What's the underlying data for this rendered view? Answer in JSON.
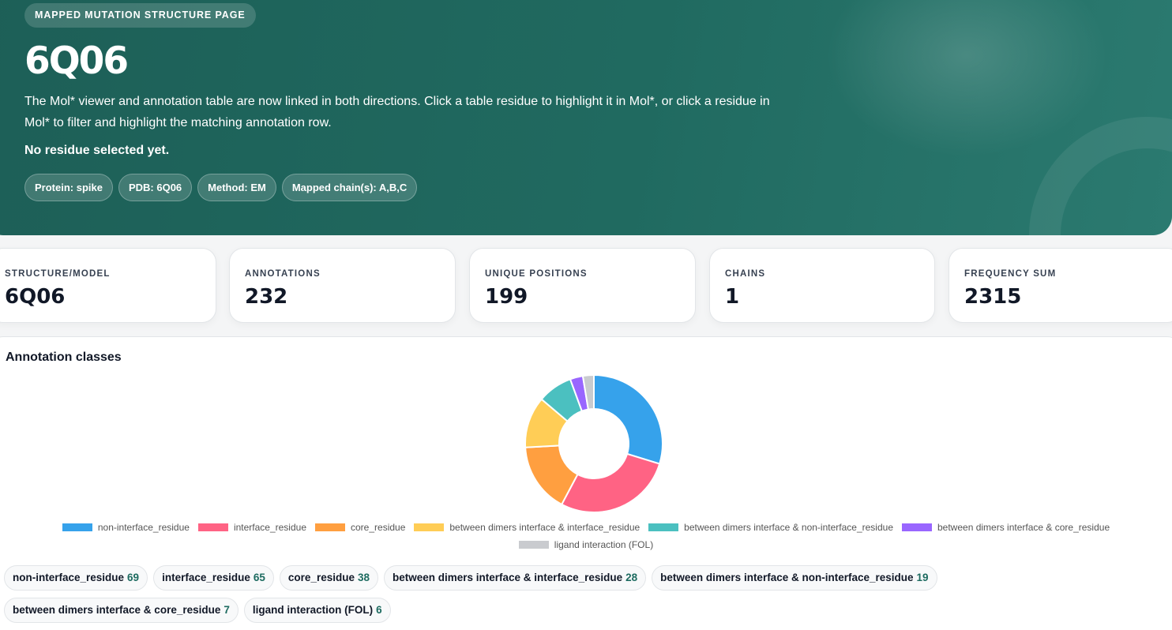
{
  "hero": {
    "kicker": "MAPPED MUTATION STRUCTURE PAGE",
    "title": "6Q06",
    "description": "The Mol* viewer and annotation table are now linked in both directions. Click a table residue to highlight it in Mol*, or click a residue in Mol* to filter and highlight the matching annotation row.",
    "status": "No residue selected yet.",
    "chips": [
      "Protein: spike",
      "PDB: 6Q06",
      "Method: EM",
      "Mapped chain(s): A,B,C"
    ]
  },
  "stats": [
    {
      "label": "STRUCTURE/MODEL",
      "value": "6Q06"
    },
    {
      "label": "ANNOTATIONS",
      "value": "232"
    },
    {
      "label": "UNIQUE POSITIONS",
      "value": "199"
    },
    {
      "label": "CHAINS",
      "value": "1"
    },
    {
      "label": "FREQUENCY SUM",
      "value": "2315"
    }
  ],
  "annotation_panel": {
    "title": "Annotation classes"
  },
  "chart_data": {
    "type": "pie",
    "variant": "doughnut",
    "legend_position": "bottom",
    "categories": [
      "non-interface_residue",
      "interface_residue",
      "core_residue",
      "between dimers interface & interface_residue",
      "between dimers interface & non-interface_residue",
      "between dimers interface & core_residue",
      "ligand interaction (FOL)"
    ],
    "values": [
      69,
      65,
      38,
      28,
      19,
      7,
      6
    ],
    "colors": [
      "#36a2eb",
      "#ff6384",
      "#ff9f40",
      "#ffcd56",
      "#4bc0c0",
      "#9966ff",
      "#c9cbcf"
    ]
  },
  "icons": {}
}
